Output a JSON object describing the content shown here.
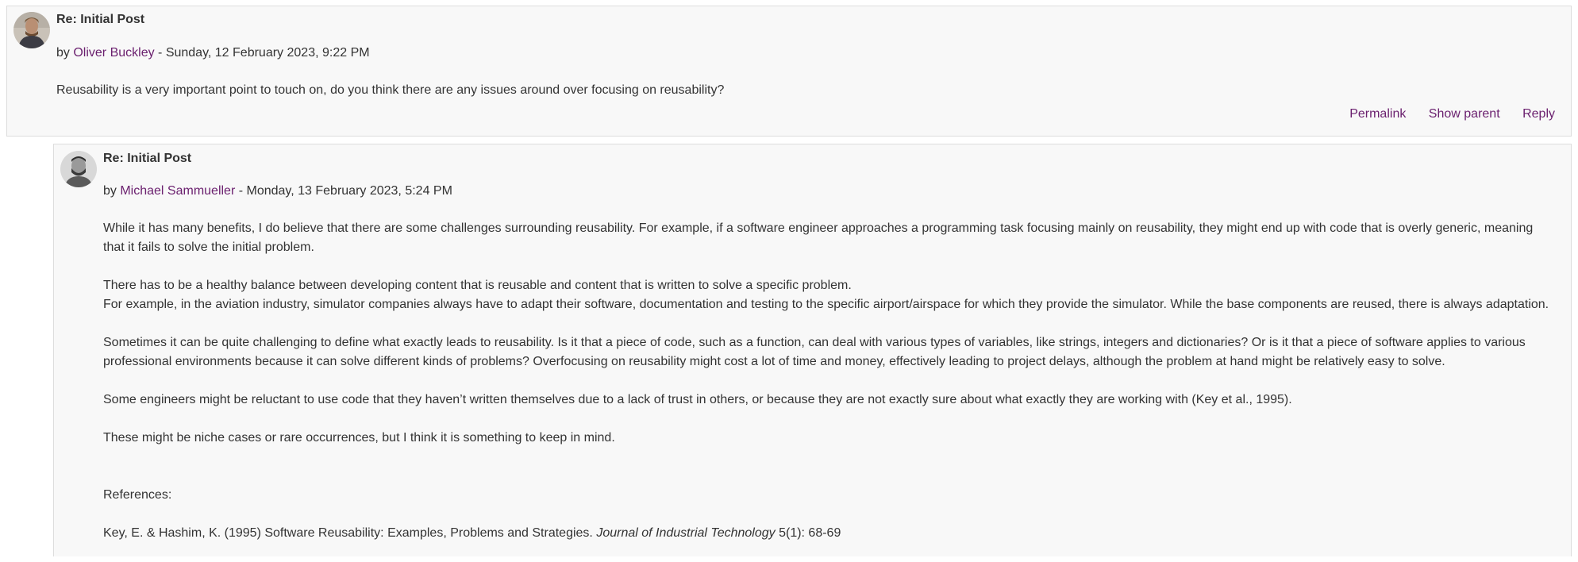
{
  "posts": [
    {
      "subject": "Re: Initial Post",
      "by_prefix": "by ",
      "author": "Oliver Buckley",
      "date_sep": " - ",
      "date": "Sunday, 12 February 2023, 9:22 PM",
      "body": [
        "Reusability is a very important point to touch on, do you think there are any issues around over focusing on reusability?"
      ],
      "actions": {
        "permalink": "Permalink",
        "show_parent": "Show parent",
        "reply": "Reply"
      }
    },
    {
      "subject": "Re: Initial Post",
      "by_prefix": "by ",
      "author": "Michael Sammueller",
      "date_sep": " - ",
      "date": "Monday, 13 February 2023, 5:24 PM",
      "body": [
        "While it has many benefits, I do believe that there are some challenges surrounding reusability. For example, if a software engineer approaches a programming task focusing mainly on reusability, they might end up with code that is overly generic, meaning that it fails to solve the initial problem.",
        "There has to be a healthy balance between developing content that is reusable and content that is written to solve a specific problem.",
        "For example, in the aviation industry, simulator companies always have to adapt their software, documentation and testing to the specific airport/airspace for which they provide the simulator. While the base components are reused, there is always adaptation.",
        "Sometimes it can be quite challenging to define what exactly leads to reusability. Is it that a piece of code, such as a function, can deal with various types of variables, like strings, integers and dictionaries? Or is it that a piece of software applies to various professional environments because it can solve different kinds of problems? Overfocusing on reusability might cost a lot of time and money, effectively leading to project delays, although the problem at hand might be relatively easy to solve.",
        "Some engineers might be reluctant to use code that they haven’t written themselves due to a lack of trust in others, or because they are not exactly sure about what exactly they are working with (Key et al., 1995).",
        "These might be niche cases or rare occurrences, but I think it is something to keep in mind.",
        "References:"
      ],
      "reference": {
        "text": "Key, E. & Hashim, K. (1995) Software Reusability: Examples, Problems and Strategies. ",
        "journal": "Journal of Industrial Technology",
        "tail": " 5(1): 68-69"
      }
    }
  ],
  "colors": {
    "link": "#6a1f6e",
    "post_bg": "#f8f8f8",
    "border": "#dddddd",
    "text": "#333333"
  },
  "icons": {
    "avatar_1": "user-avatar-photo",
    "avatar_2": "user-avatar-photo"
  }
}
